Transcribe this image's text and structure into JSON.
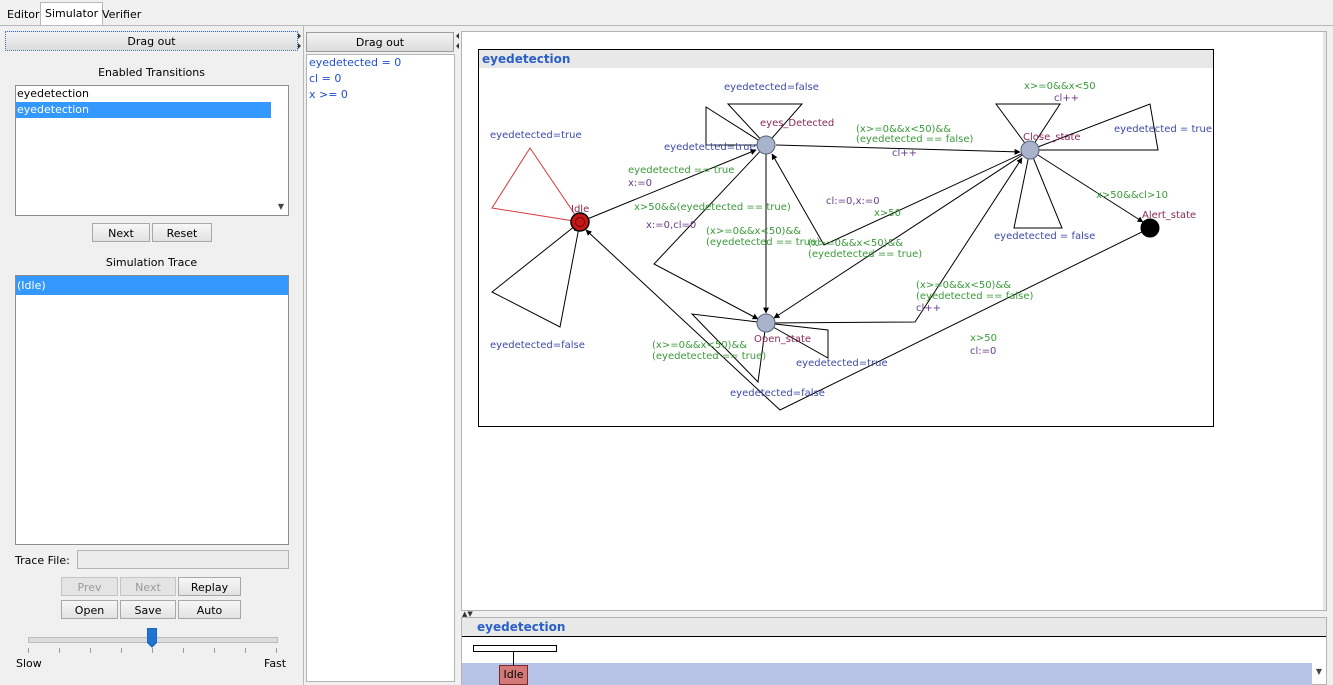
{
  "tabs": [
    "Editor",
    "Simulator",
    "Verifier"
  ],
  "left": {
    "drag_out": "Drag out",
    "enabled_transitions_title": "Enabled Transitions",
    "transitions": [
      "eyedetection",
      "eyedetection"
    ],
    "next": "Next",
    "reset": "Reset",
    "simulation_trace_title": "Simulation Trace",
    "trace": [
      "(Idle)"
    ],
    "trace_file_label": "Trace File:",
    "trace_file_value": "",
    "prev": "Prev",
    "next2": "Next",
    "replay": "Replay",
    "open": "Open",
    "save": "Save",
    "auto": "Auto",
    "slow": "Slow",
    "fast": "Fast",
    "speed_fraction": 0.5
  },
  "middle": {
    "drag_out": "Drag out",
    "variables": [
      "eyedetected = 0",
      "cl = 0",
      "x >= 0"
    ]
  },
  "diagram": {
    "title": "eyedetection",
    "states": {
      "idle": "Idle",
      "eyes_detected": "eyes_Detected",
      "close_state": "Close_state",
      "alert_state": "Alert_state",
      "open_state": "Open_state"
    },
    "labels": {
      "idle_loop_top": "eyedetected=true",
      "idle_loop_bottom": "eyedetected=false",
      "ed_loop_top": "eyedetected=false",
      "ed_loop_left": "eyedetected=true",
      "idle_to_ed_guard": "eyedetected == true",
      "idle_to_ed_assign": "x:=0",
      "ed_to_close_guard1": "(x>=0&&x<50)&&",
      "ed_to_close_guard2": "(eyedetected == false)",
      "ed_to_close_assign": "cl++",
      "close_loop_top1": "x>=0&&x<50",
      "close_loop_top2": "cl++",
      "close_loop_right": "eyedetected = true",
      "close_loop_bottom": "eyedetected = false",
      "close_to_alert": "x>50&&cl>10",
      "close_to_ed_assign": "cl:=0,x:=0",
      "x_gt_50": "x>50",
      "idle_to_open": "x>50&&(eyedetected == true)",
      "open_assign": "x:=0,cl=0",
      "ed_to_open1": "(x>=0&&x<50)&&",
      "ed_to_open2": "(eyedetected == true)",
      "close_to_open1": "(x>=0&&x<50)&&",
      "close_to_open2": "(eyedetected == true)",
      "open_to_close1": "(x>=0&&x<50)&&",
      "open_to_close2": "(eyedetected == false)",
      "open_to_close3": "cl++",
      "alert_to_open1": "x>50",
      "alert_to_open2": "cl:=0",
      "open_loop_left1": "(x>=0&&x<50)&&",
      "open_loop_left2": "(eyedetected == true)",
      "open_loop_right": "eyedetected=true",
      "open_loop_bottom": "eyedetected=false"
    }
  },
  "msc": {
    "title": "eyedetection",
    "state": "Idle"
  }
}
